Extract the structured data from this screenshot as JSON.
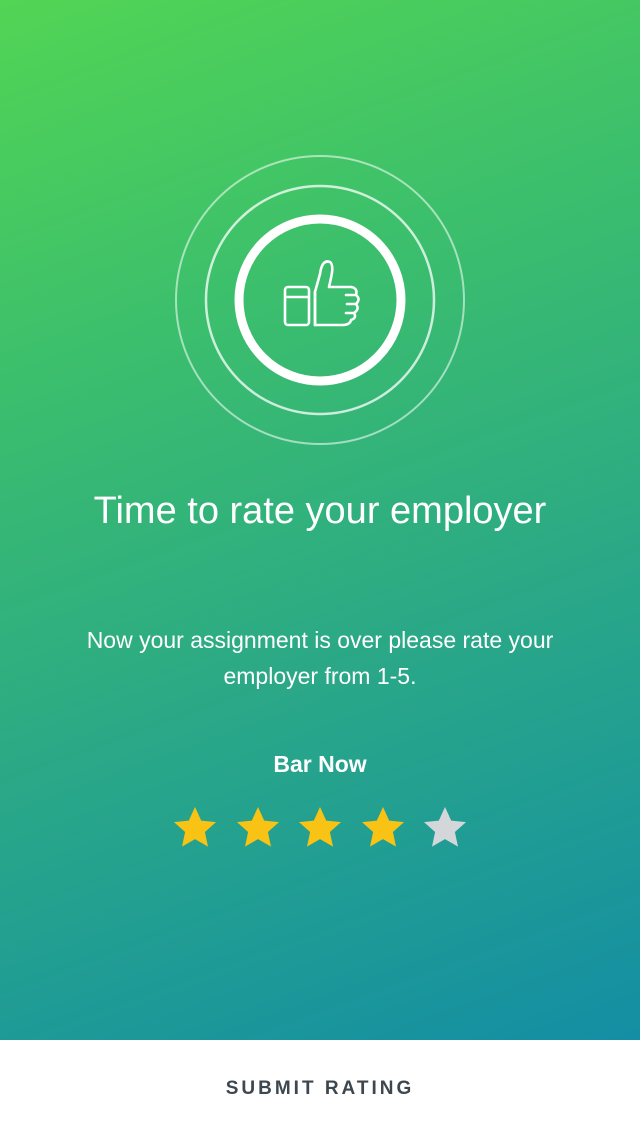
{
  "rating_prompt": {
    "title": "Time to rate your employer",
    "subtitle": "Now your assignment is over please rate your employer from 1-5.",
    "employer_name": "Bar Now",
    "rating": {
      "value": 4,
      "max": 5,
      "filled_color": "#f8c314",
      "empty_color": "#d4d7da"
    },
    "icon": "thumbs-up-icon"
  },
  "footer": {
    "submit_label": "SUBMIT RATING"
  },
  "colors": {
    "gradient_start": "#52d554",
    "gradient_end": "#138ea4",
    "footer_text": "#3c4750"
  }
}
